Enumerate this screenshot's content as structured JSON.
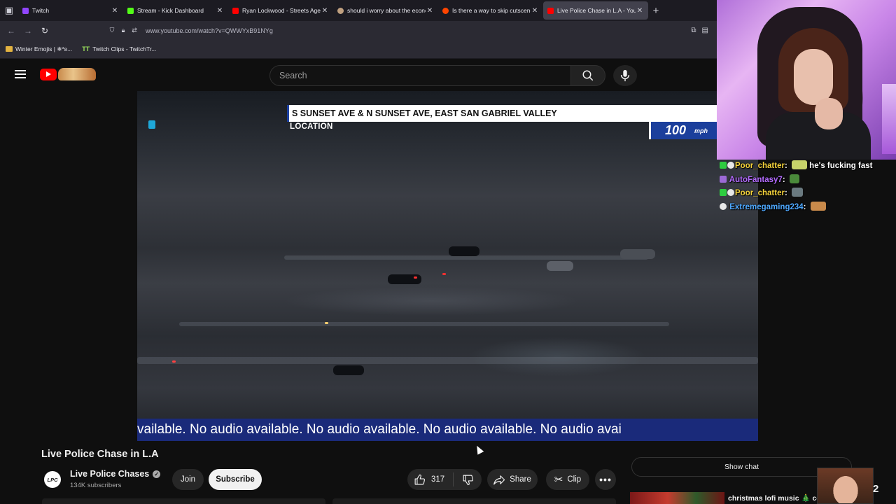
{
  "browser": {
    "tabs": [
      {
        "title": "Twitch",
        "favicon": "twitch-icon",
        "active": false
      },
      {
        "title": "Stream - Kick Dashboard",
        "favicon": "kick-icon",
        "active": false
      },
      {
        "title": "Ryan Lockwood - Streets Agent",
        "favicon": "youtube-icon",
        "active": false
      },
      {
        "title": "should i worry about the econo",
        "favicon": "globe-icon",
        "active": false
      },
      {
        "title": "Is there a way to skip cutscenes",
        "favicon": "reddit-icon",
        "active": false
      },
      {
        "title": "Live Police Chase in L.A - YouTu",
        "favicon": "youtube-icon",
        "active": true
      }
    ],
    "url": "www.youtube.com/watch?v=QWWYxB91NYg",
    "bookmarks": [
      {
        "label": "Winter Emojis | ❄*ʚ...",
        "icon": "folder-icon"
      },
      {
        "label": "Twitch Clips - TwitchTr...",
        "icon": "tt-icon"
      }
    ]
  },
  "youtube": {
    "search_placeholder": "Search",
    "video": {
      "location_text": "S SUNSET AVE & N SUNSET AVE, EAST SAN GABRIEL VALLEY",
      "location_label": "LOCATION",
      "speed_value": "100",
      "speed_unit": "mph",
      "ticker_text": "vailable.  No audio available.  No audio available.  No audio available.  No audio avai"
    },
    "title": "Live Police Chase in L.A",
    "channel": {
      "name": "Live Police Chases",
      "avatar_text": "LPC",
      "subscribers": "134K subscribers"
    },
    "buttons": {
      "join": "Join",
      "subscribe": "Subscribe",
      "likes": "317",
      "share": "Share",
      "clip": "Clip",
      "show_chat": "Show chat"
    },
    "recommended": {
      "title": "christmas lofi music 🎄 co"
    }
  },
  "overlay": {
    "chat": [
      {
        "user": "Poor_chatter",
        "message": "he's fucking fast",
        "color": "#f5d33b"
      },
      {
        "user": "AutoFantasy7",
        "message": "",
        "color": "#b36bff"
      },
      {
        "user": "Poor_chatter",
        "message": "",
        "color": "#f5d33b"
      },
      {
        "user": "Extremegaming234",
        "message": "",
        "color": "#4ea8ff"
      }
    ],
    "pip_number": "2"
  }
}
